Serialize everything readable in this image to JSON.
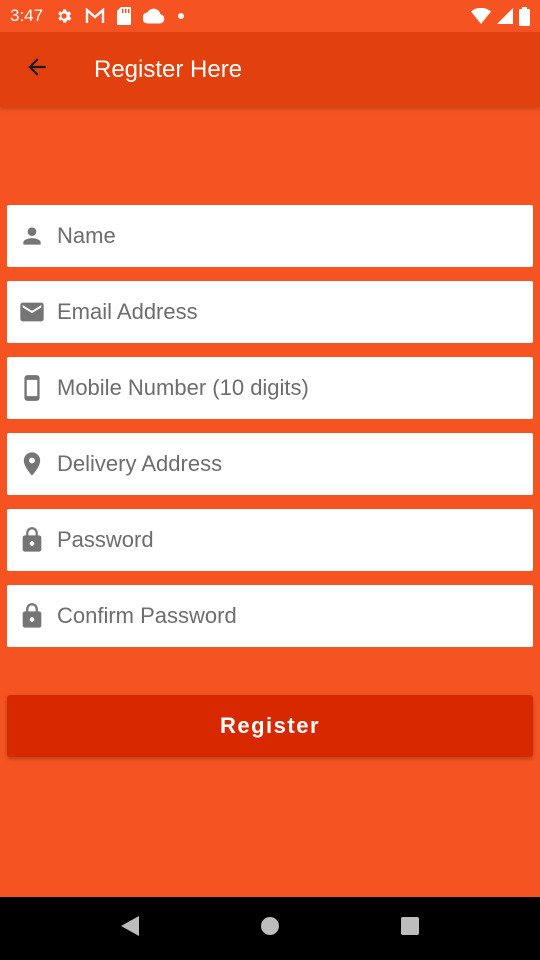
{
  "status_bar": {
    "time": "3:47",
    "icons": [
      "gear-icon",
      "gmail-icon",
      "sd-card-icon",
      "cloud-icon",
      "dot-icon",
      "wifi-icon",
      "signal-icon",
      "battery-icon"
    ]
  },
  "app_bar": {
    "title": "Register Here",
    "back_icon": "arrow-back-icon"
  },
  "form": {
    "fields": [
      {
        "placeholder": "Name",
        "icon": "person-icon"
      },
      {
        "placeholder": "Email Address",
        "icon": "email-icon"
      },
      {
        "placeholder": "Mobile Number (10 digits)",
        "icon": "phone-icon"
      },
      {
        "placeholder": "Delivery Address",
        "icon": "location-icon"
      },
      {
        "placeholder": "Password",
        "icon": "lock-icon"
      },
      {
        "placeholder": "Confirm Password",
        "icon": "lock-icon"
      }
    ],
    "submit_label": "Register"
  },
  "colors": {
    "background": "#F55422",
    "app_bar": "#E2400D",
    "button": "#D72800",
    "icon": "#757575"
  }
}
